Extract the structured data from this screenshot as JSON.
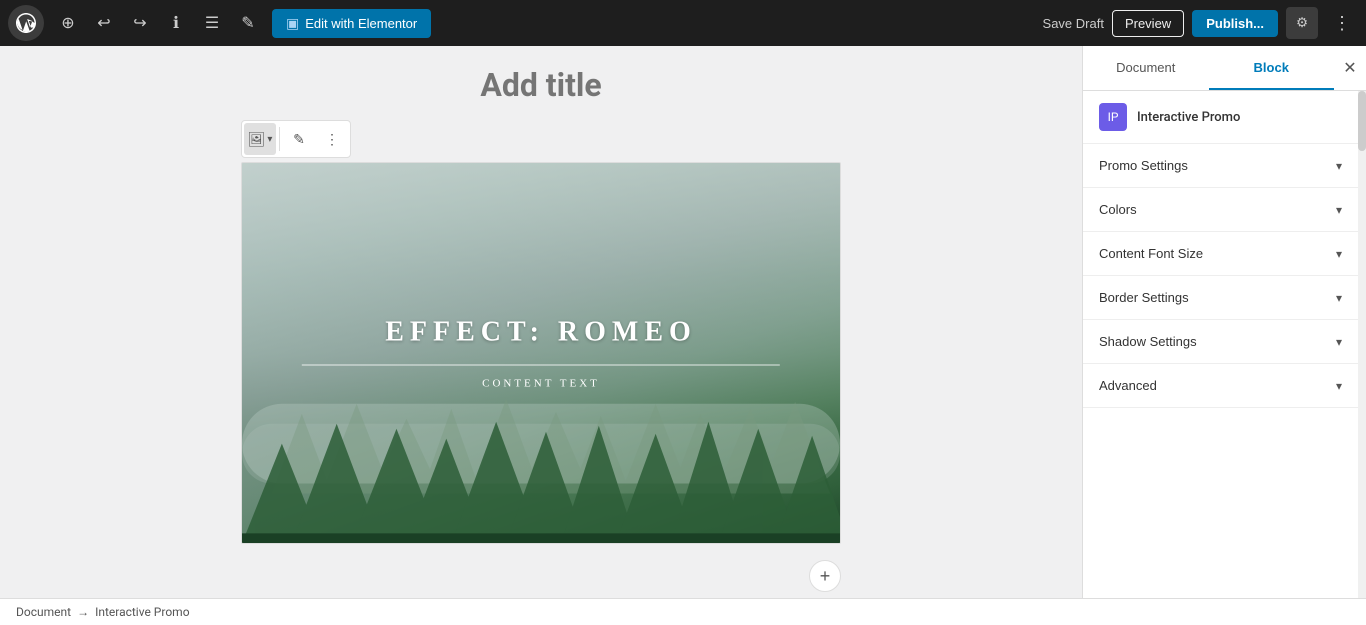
{
  "toolbar": {
    "edit_elementor_label": "Edit with Elementor",
    "save_draft_label": "Save Draft",
    "preview_label": "Preview",
    "publish_label": "Publish...",
    "add_icon": "⊕",
    "undo_icon": "↩",
    "redo_icon": "↪",
    "info_icon": "ℹ",
    "list_icon": "☰",
    "pencil_icon": "✎",
    "settings_icon": "⚙",
    "more_icon": "⋮"
  },
  "editor": {
    "page_title_placeholder": "Add title",
    "block_toolbar": {
      "image_btn": "🖼",
      "edit_btn": "✎",
      "more_btn": "⋮"
    },
    "promo": {
      "effect_title": "EFFECT:  ROMEO",
      "content_text": "CONTENT TEXT"
    }
  },
  "breadcrumb": {
    "document": "Document",
    "arrow": "→",
    "current": "Interactive Promo"
  },
  "sidebar": {
    "tab_document": "Document",
    "tab_block": "Block",
    "close_icon": "✕",
    "plugin_icon_text": "IP",
    "plugin_name": "Interactive Promo",
    "accordion": [
      {
        "label": "Promo Settings",
        "id": "promo-settings"
      },
      {
        "label": "Colors",
        "id": "colors"
      },
      {
        "label": "Content Font Size",
        "id": "content-font-size"
      },
      {
        "label": "Border Settings",
        "id": "border-settings"
      },
      {
        "label": "Shadow Settings",
        "id": "shadow-settings"
      },
      {
        "label": "Advanced",
        "id": "advanced"
      }
    ]
  },
  "colors": {
    "toolbar_bg": "#1e1e1e",
    "active_tab": "#007cba",
    "publish_bg": "#0073aa",
    "edit_elementor_bg": "#0073aa",
    "plugin_icon_bg": "#6c5ce7"
  }
}
